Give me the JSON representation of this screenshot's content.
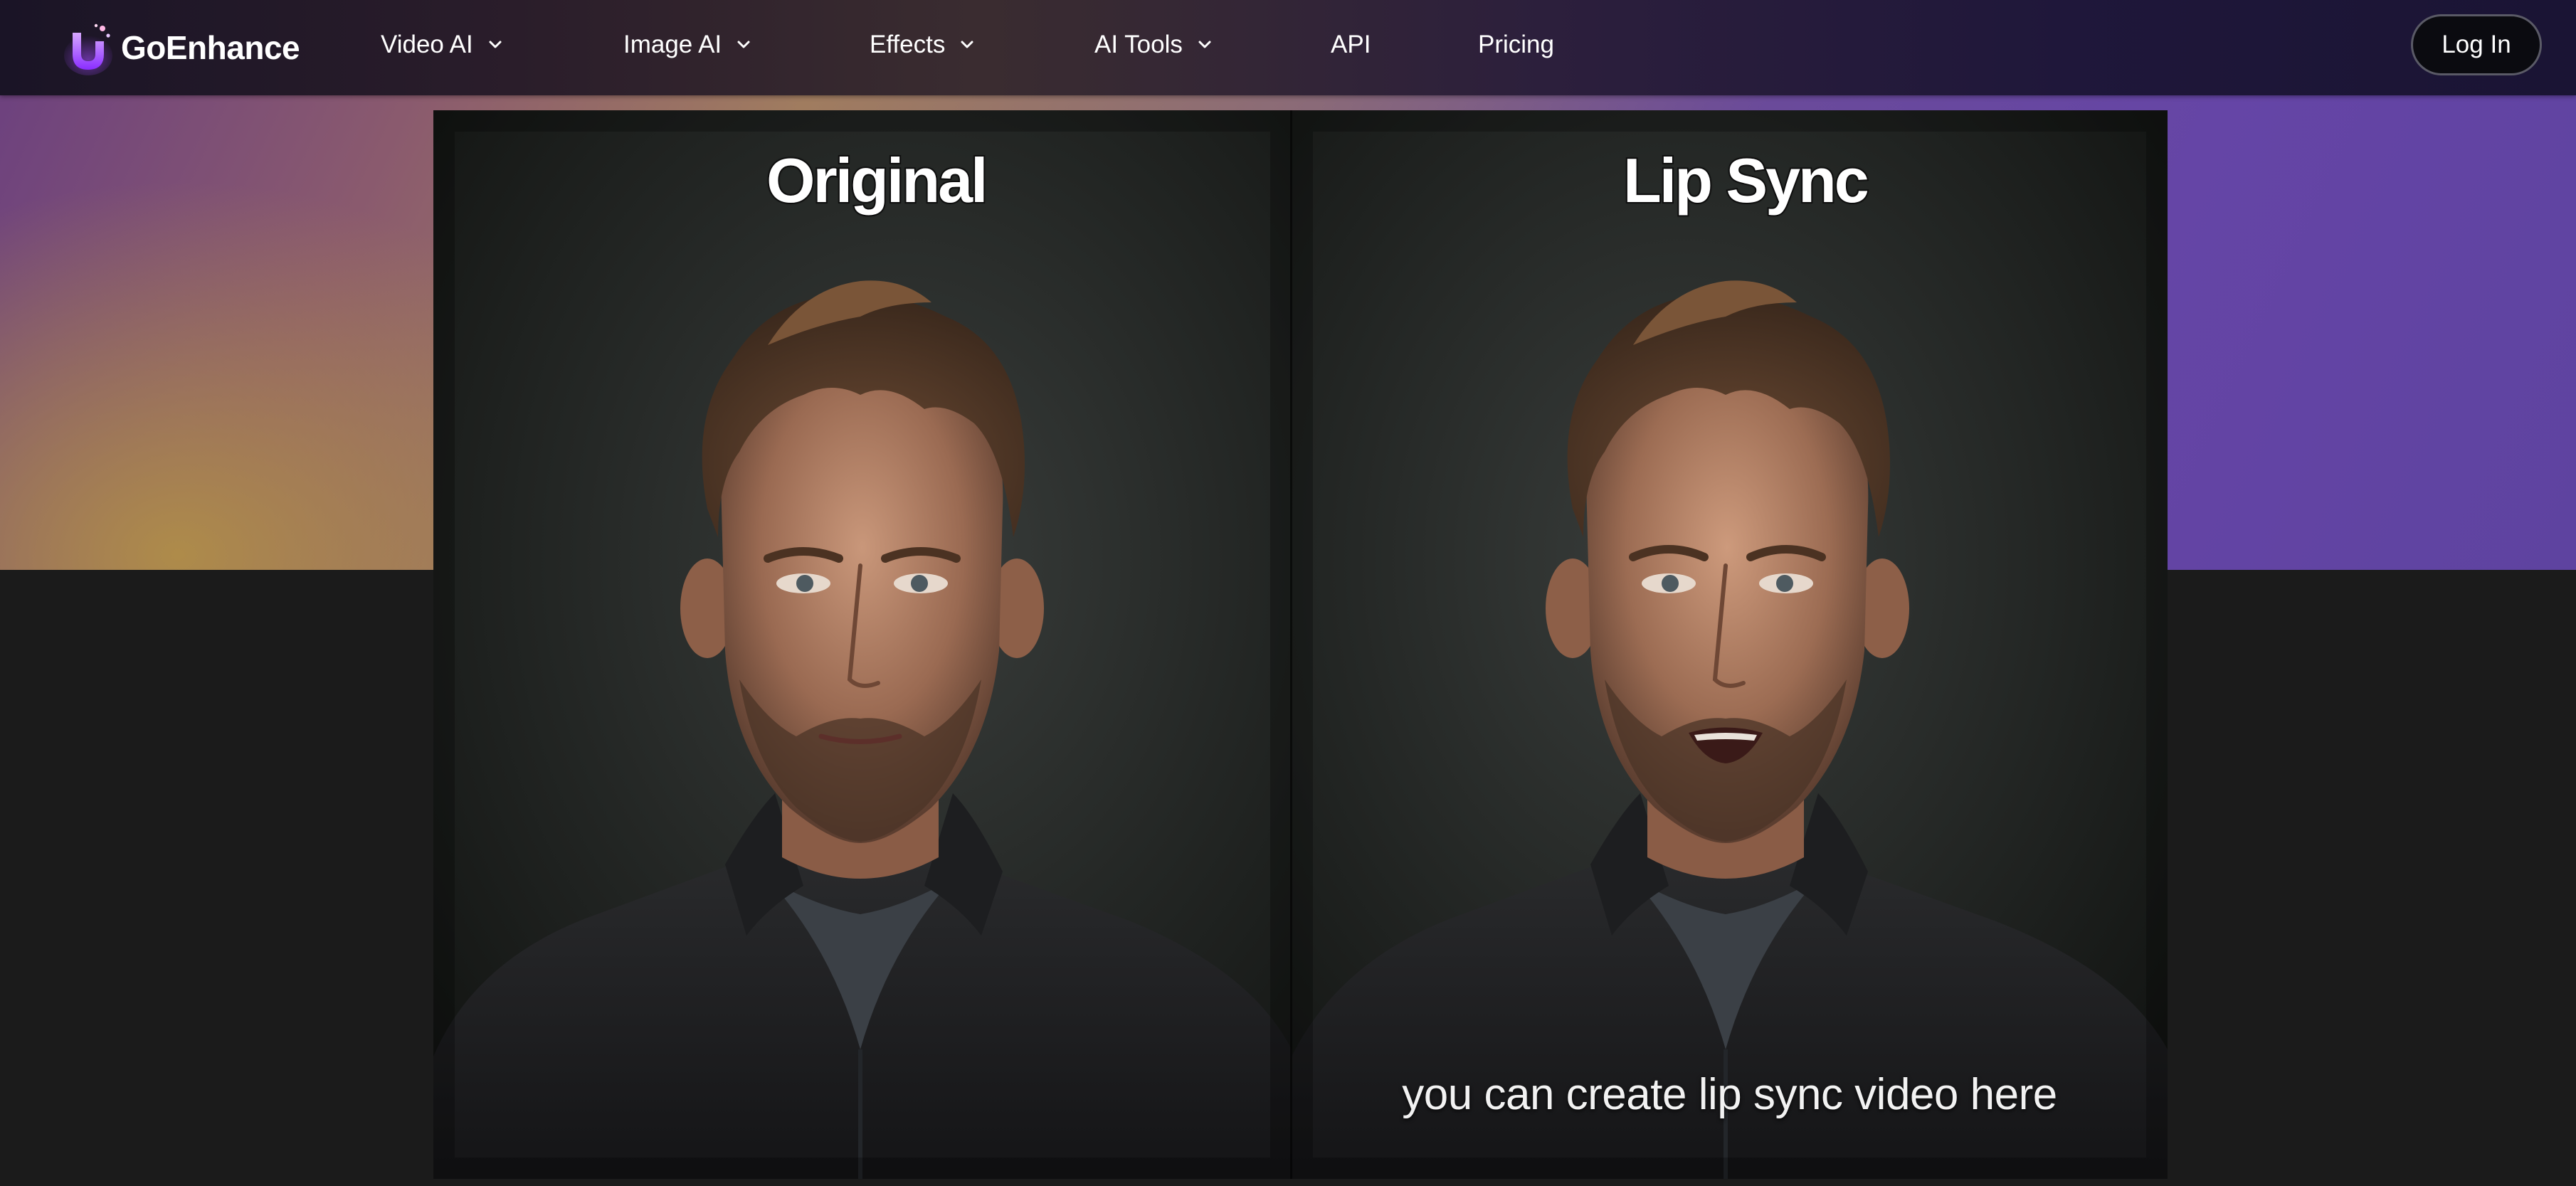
{
  "header": {
    "brand": "GoEnhance",
    "nav": [
      {
        "label": "Video AI",
        "has_dropdown": true
      },
      {
        "label": "Image AI",
        "has_dropdown": true
      },
      {
        "label": "Effects",
        "has_dropdown": true
      },
      {
        "label": "AI Tools",
        "has_dropdown": true
      },
      {
        "label": "API",
        "has_dropdown": false
      },
      {
        "label": "Pricing",
        "has_dropdown": false
      }
    ],
    "login_label": "Log In"
  },
  "comparison": {
    "left_label": "Original",
    "right_label": "Lip Sync",
    "caption": "you can create lip sync video here"
  },
  "colors": {
    "brand_accent": "#a34bff",
    "hero_purple": "#6545a6",
    "hero_gold": "#b08e48",
    "page_dark": "#1b1b1b"
  },
  "icons": {
    "logo": "goenhance-logo-icon",
    "dropdown": "chevron-down-icon"
  }
}
